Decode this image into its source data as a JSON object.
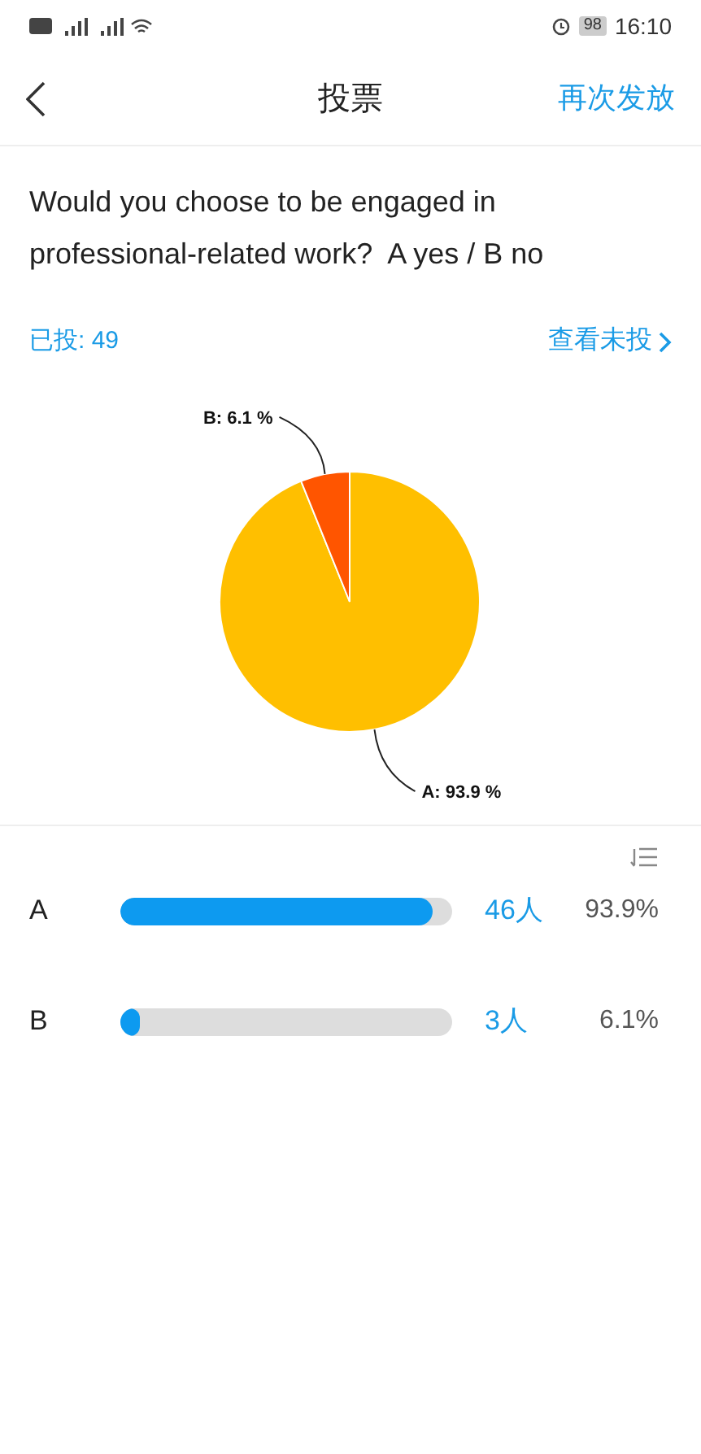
{
  "status_bar": {
    "battery": "98",
    "time": "16:10"
  },
  "nav": {
    "title": "投票",
    "action": "再次发放"
  },
  "question": "Would you choose to be engaged in professional-related work?  A yes / B no",
  "voted": "已投: 49",
  "view_unvoted": "查看未投",
  "chart_data": {
    "type": "pie",
    "values": [
      93.9,
      6.1
    ],
    "colors": [
      "#ffbf00",
      "#ff5500"
    ],
    "value_labels": [
      "A: 93.9 %",
      "B: 6.1 %"
    ]
  },
  "options": [
    {
      "label": "A",
      "level": 0.939,
      "count": "46人",
      "percent": "93.9%"
    },
    {
      "label": "B",
      "level": 0.061,
      "count": "3人",
      "percent": "6.1%"
    }
  ]
}
